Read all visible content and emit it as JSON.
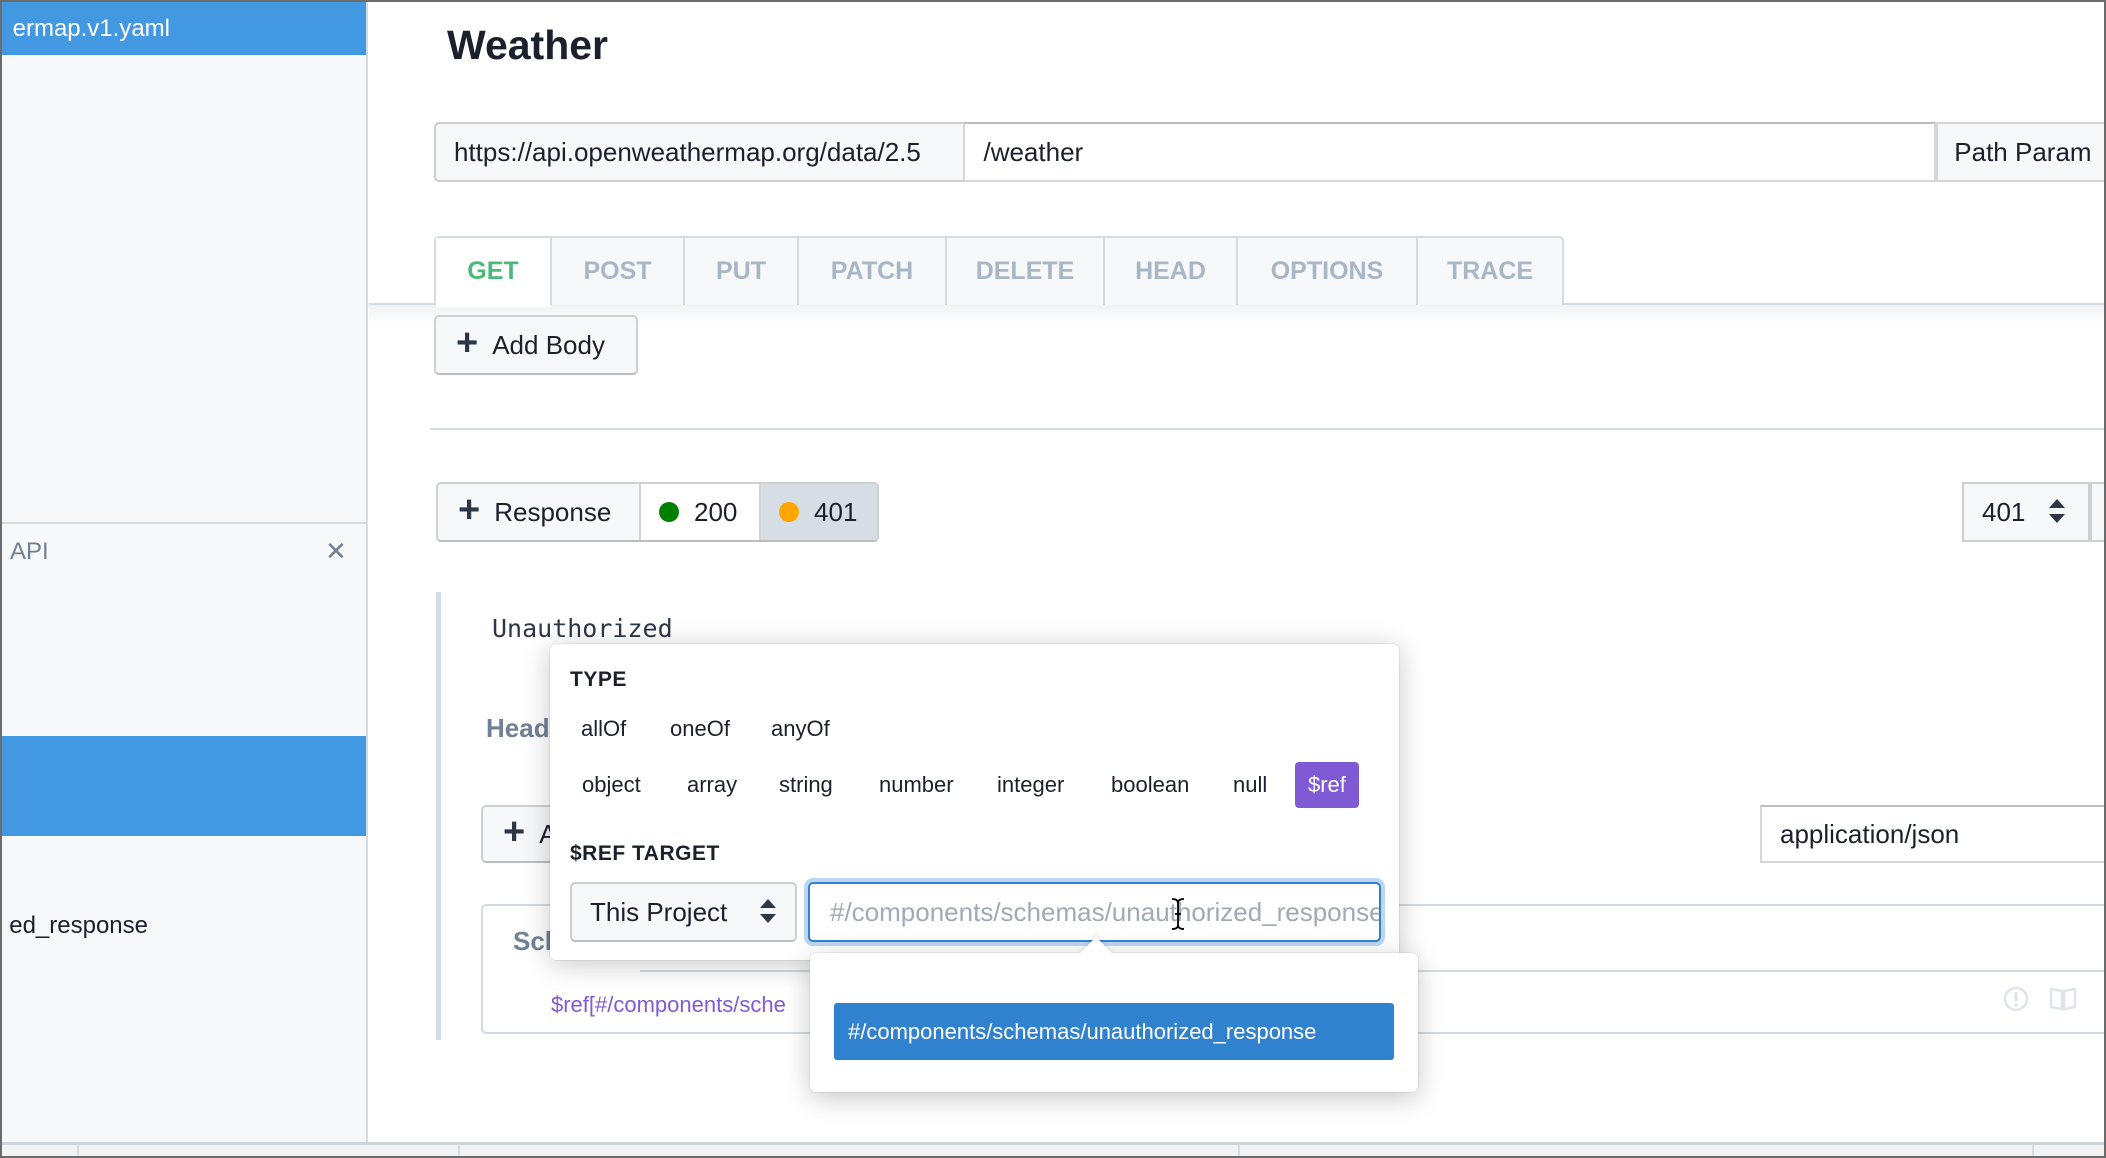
{
  "sidebar": {
    "file_name": "ermap.v1.yaml",
    "section_title": "API",
    "close_icon": "close-icon",
    "item_label": "ed_response"
  },
  "main": {
    "title": "Weather",
    "url": {
      "base": "https://api.openweathermap.org/data/2.5",
      "path": "/weather",
      "params_button": "Path Param"
    },
    "methods": [
      {
        "label": "GET",
        "active": true
      },
      {
        "label": "POST",
        "active": false
      },
      {
        "label": "PUT",
        "active": false
      },
      {
        "label": "PATCH",
        "active": false
      },
      {
        "label": "DELETE",
        "active": false
      },
      {
        "label": "HEAD",
        "active": false
      },
      {
        "label": "OPTIONS",
        "active": false
      },
      {
        "label": "TRACE",
        "active": false
      }
    ],
    "add_body_label": "Add Body",
    "responses": {
      "add_label": "Response",
      "codes": [
        {
          "code": "200",
          "color": "#008000",
          "active": false
        },
        {
          "code": "401",
          "color": "#ffa500",
          "active": true
        }
      ],
      "selected_code": "401"
    },
    "response_detail": {
      "description": "Unauthorized",
      "headers_label": "Head",
      "add_label": "A",
      "content_type": "application/json",
      "schema_tab": "Sch",
      "schema_ref": "$ref[#/components/sche"
    }
  },
  "popover": {
    "type_label": "TYPE",
    "combinators": [
      "allOf",
      "oneOf",
      "anyOf"
    ],
    "types": [
      "object",
      "array",
      "string",
      "number",
      "integer",
      "boolean",
      "null",
      "$ref"
    ],
    "active_type": "$ref",
    "ref_target_label": "$REF TARGET",
    "ref_source": "This Project",
    "ref_input_value": "",
    "ref_input_placeholder": "#/components/schemas/unauthorized_response",
    "suggestions": [
      "#/components/schemas/unauthorized_response"
    ]
  },
  "colors": {
    "accent_blue": "#4299e1",
    "get_green": "#48bb78",
    "ref_purple": "#805ad5",
    "selection_blue": "#3182ce"
  }
}
